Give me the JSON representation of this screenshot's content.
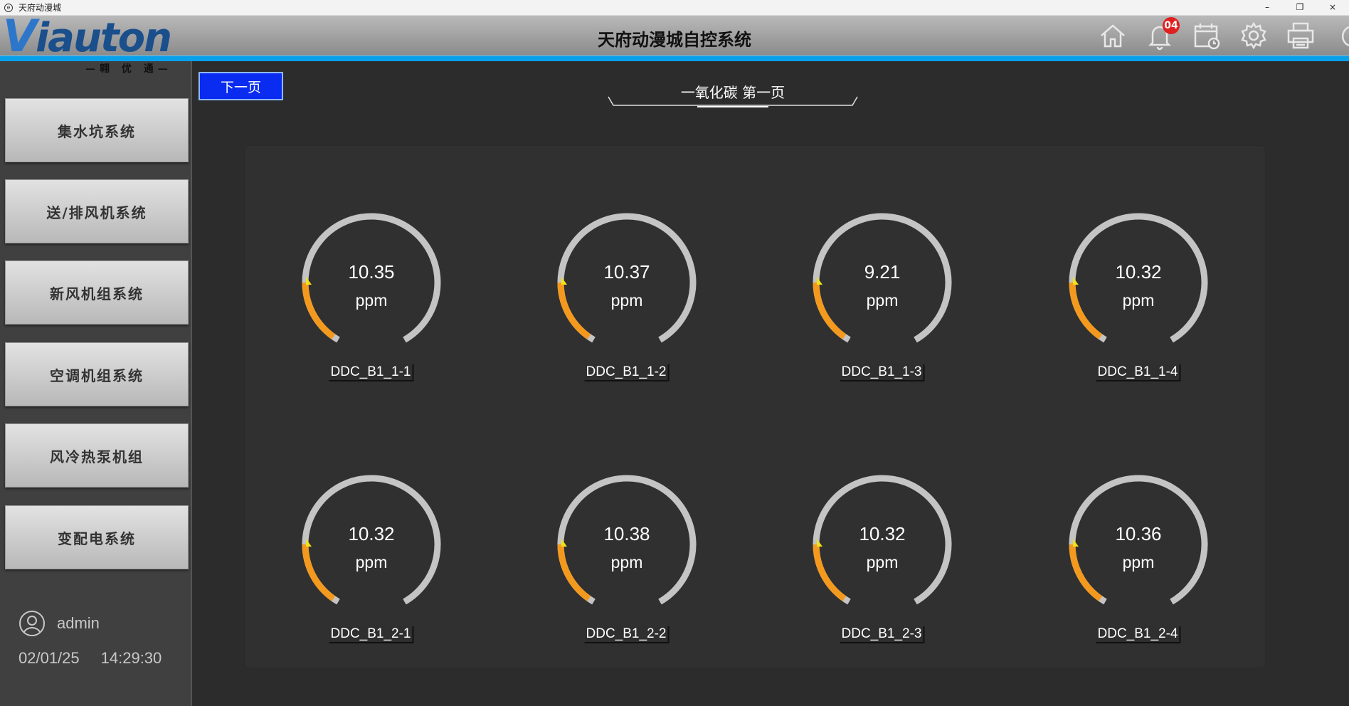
{
  "window": {
    "title": "天府动漫城",
    "controls": [
      "–",
      "❐",
      "×"
    ]
  },
  "header": {
    "logo_text_v": "V",
    "logo_text_rest": "iauton",
    "logo_sub": "—翱 优 通—",
    "system_title": "天府动漫城自控系统",
    "notification_count": "04",
    "icons": [
      "home-icon",
      "bell-icon",
      "calendar-icon",
      "gear-icon",
      "printer-icon",
      "power-icon"
    ],
    "accent_color": "#0aa0ea"
  },
  "sidebar": {
    "items": [
      {
        "label": "集水坑系统"
      },
      {
        "label": "送/排风机系统"
      },
      {
        "label": "新风机组系统"
      },
      {
        "label": "空调机组系统"
      },
      {
        "label": "风冷热泵机组"
      },
      {
        "label": "变配电系统"
      }
    ],
    "user": "admin",
    "date": "02/01/25",
    "time": "14:29:30"
  },
  "main": {
    "next_button": "下一页",
    "page_title": "一氧化碳 第一页",
    "gauges": [
      {
        "value": "10.35",
        "unit": "ppm",
        "name": "DDC_B1_1-1"
      },
      {
        "value": "10.37",
        "unit": "ppm",
        "name": "DDC_B1_1-2"
      },
      {
        "value": "9.21",
        "unit": "ppm",
        "name": "DDC_B1_1-3"
      },
      {
        "value": "10.32",
        "unit": "ppm",
        "name": "DDC_B1_1-4"
      },
      {
        "value": "10.32",
        "unit": "ppm",
        "name": "DDC_B1_2-1"
      },
      {
        "value": "10.38",
        "unit": "ppm",
        "name": "DDC_B1_2-2"
      },
      {
        "value": "10.32",
        "unit": "ppm",
        "name": "DDC_B1_2-3"
      },
      {
        "value": "10.36",
        "unit": "ppm",
        "name": "DDC_B1_2-4"
      }
    ],
    "gauge_colors": {
      "track": "#c4c4c4",
      "fill": "#f39a1e",
      "pointer": "#f2e21b"
    }
  }
}
